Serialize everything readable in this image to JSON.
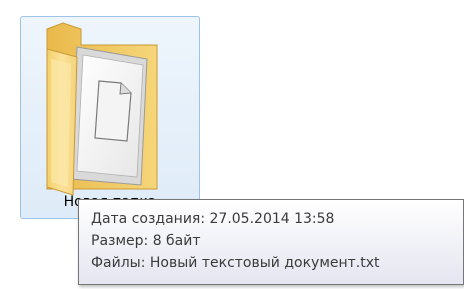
{
  "folder": {
    "label": "Новая папка",
    "icon": "folder-with-document-icon",
    "selected": true
  },
  "tooltip": {
    "lines": [
      "Дата создания: 27.05.2014 13:58",
      "Размер: 8 байт",
      "Файлы: Новый текстовый документ.txt"
    ]
  },
  "colors": {
    "selection_border": "#9dc3e6",
    "selection_fill": "#e6f0fa",
    "folder_yellow": "#f5d77a",
    "tooltip_border": "#767676",
    "tooltip_text": "#3b3b3b"
  }
}
